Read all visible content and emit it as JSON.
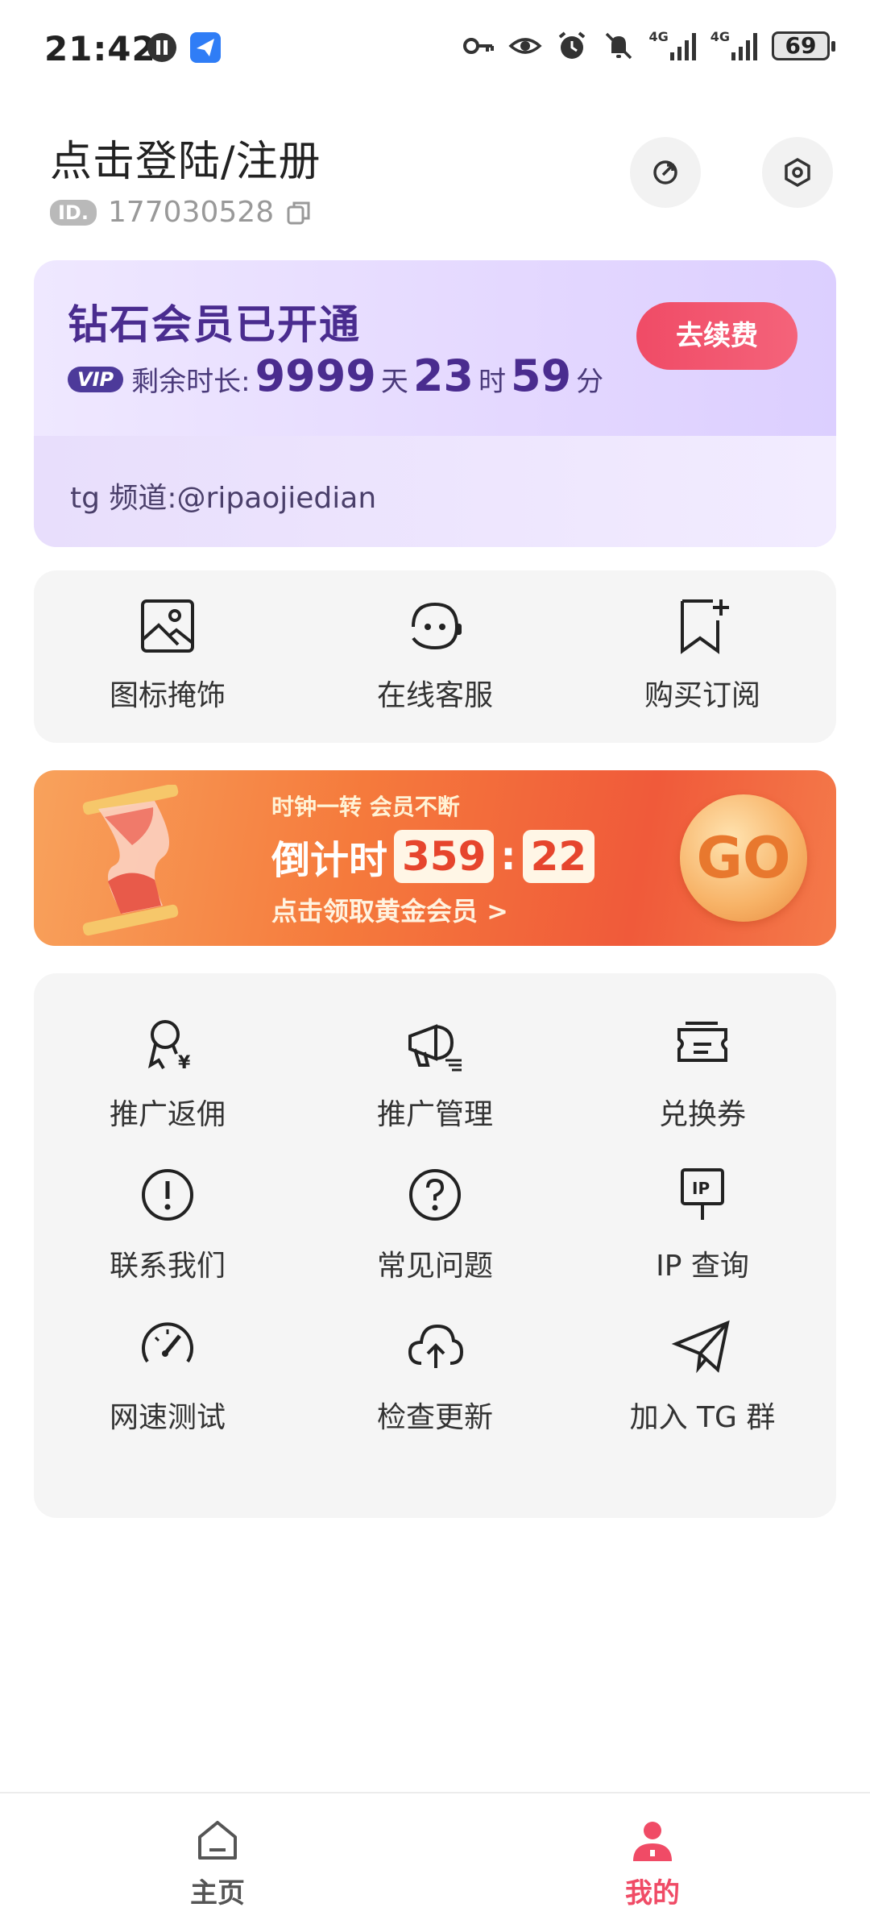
{
  "status_bar": {
    "time": "21:42",
    "battery": "69",
    "network_1": "4G",
    "network_2": "4G",
    "left_icons": [
      "pause-circle-icon",
      "plane-app-icon"
    ],
    "right_icons": [
      "key-icon",
      "eye-icon",
      "alarm-icon",
      "mute-bell-icon",
      "signal-icon",
      "signal-icon",
      "battery-icon"
    ]
  },
  "header": {
    "title": "点击登陆/注册",
    "id_badge": "ID.",
    "id_number": "177030528"
  },
  "vip": {
    "title": "钻石会员已开通",
    "tag": "VIP",
    "remaining_label": "剩余时长:",
    "days": "9999",
    "days_unit": "天",
    "hours": "23",
    "hours_unit": "时",
    "minutes": "59",
    "minutes_unit": "分",
    "renew_label": "去续费",
    "channel": "tg 频道:@ripaojiedian"
  },
  "quick": {
    "items": [
      {
        "label": "图标掩饰",
        "icon": "image-icon"
      },
      {
        "label": "在线客服",
        "icon": "customer-service-icon"
      },
      {
        "label": "购买订阅",
        "icon": "bookmark-add-icon"
      }
    ]
  },
  "banner": {
    "slogan": "时钟一转 会员不断",
    "countdown_label": "倒计时",
    "count_a": "359",
    "count_b": "22",
    "sub": "点击领取黄金会员 >",
    "go": "GO"
  },
  "features": {
    "items": [
      {
        "label": "推广返佣",
        "icon": "medal-yen-icon"
      },
      {
        "label": "推广管理",
        "icon": "megaphone-icon"
      },
      {
        "label": "兑换券",
        "icon": "ticket-icon"
      },
      {
        "label": "联系我们",
        "icon": "exclamation-circle-icon"
      },
      {
        "label": "常见问题",
        "icon": "question-circle-icon"
      },
      {
        "label": "IP 查询",
        "icon": "ip-sign-icon"
      },
      {
        "label": "网速测试",
        "icon": "speedometer-icon"
      },
      {
        "label": "检查更新",
        "icon": "cloud-upload-icon"
      },
      {
        "label": "加入 TG 群",
        "icon": "paper-plane-icon"
      }
    ]
  },
  "nav": {
    "home_label": "主页",
    "mine_label": "我的",
    "active_color": "#f04b66",
    "inactive_color": "#555555"
  }
}
